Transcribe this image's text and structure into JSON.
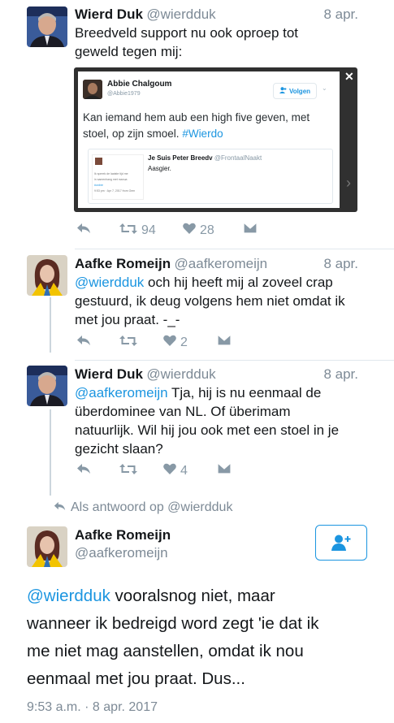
{
  "tweets": [
    {
      "name": "Wierd Duk",
      "handle": "@wierdduk",
      "date": "8 apr.",
      "text_lines": [
        "Breedveld support nu ook oproep tot",
        "geweld tegen mij:"
      ],
      "retweets": "94",
      "likes": "28"
    },
    {
      "name": "Aafke Romeijn",
      "handle": "@aafkeromeijn",
      "date": "8 apr.",
      "mention": "@wierdduk",
      "text_rest": " och hij heeft mij al zoveel crap",
      "text_lines": [
        "gestuurd, ik deug volgens hem niet omdat ik",
        "met jou praat. -_-"
      ],
      "likes": "2"
    },
    {
      "name": "Wierd Duk",
      "handle": "@wierdduk",
      "date": "8 apr.",
      "mention": "@aafkeromeijn",
      "text_rest": " Tja, hij is nu eenmaal de",
      "text_lines": [
        "überdominee van NL. Of überimam",
        "natuurlijk. Wil hij jou ook met een stoel in je",
        "gezicht slaan?"
      ],
      "likes": "4"
    }
  ],
  "embedded_card": {
    "name": "Abbie Chalgoum",
    "handle": "@Abbie1979",
    "follow_label": "Volgen",
    "text_line1": "Kan iemand hem aub een high five geven, met",
    "text_line2_plain": "stoel, op zijn smoel. ",
    "hashtag": "#Wierdo",
    "quoted_name": "Je Suis Peter Breedv",
    "quoted_handle": "@FrontaalNaakt",
    "quoted_text": "Aasgier.",
    "mini_lines": [
      "Ik spreek de laatste tijd me",
      "in samenhang met manua",
      "#onbre",
      "9:53 pm · Apr 7, 2017 from Gem"
    ],
    "close_glyph": "✕",
    "arrow_glyph": "›"
  },
  "reply_context": {
    "label": "Als antwoord op @wierdduk"
  },
  "main_tweet": {
    "name": "Aafke Romeijn",
    "handle": "@aafkeromeijn",
    "mention": "@wierdduk",
    "line1_rest": " vooralsnog niet, maar",
    "lines": [
      "wanneer ik bedreigd word zegt 'ie dat ik",
      "me niet mag aanstellen, omdat ik nou",
      "eenmaal met jou praat. Dus..."
    ],
    "timestamp": "9:53 a.m. · 8 apr. 2017"
  },
  "colors": {
    "accent": "#1b95e0",
    "muted": "#7d8a96",
    "icon": "#8899a6"
  },
  "icons": [
    "reply-icon",
    "retweet-icon",
    "like-icon",
    "dm-icon",
    "follow-user-icon"
  ]
}
